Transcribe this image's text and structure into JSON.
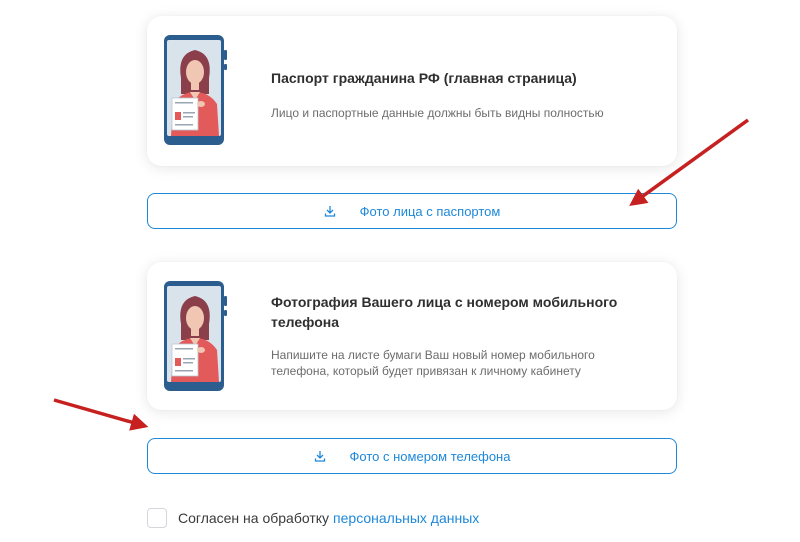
{
  "cards": [
    {
      "title": "Паспорт гражданина РФ (главная страница)",
      "description": "Лицо и паспортные данные должны быть видны полностью"
    },
    {
      "title": "Фотография Вашего лица с номером мобильного телефона",
      "description": "Напишите на листе бумаги Ваш новый номер мобильного телефона, который будет привязан к личному кабинету"
    }
  ],
  "buttons": {
    "photo_with_passport": "Фото лица с паспортом",
    "photo_with_phone": "Фото с номером телефона"
  },
  "consent": {
    "text": "Согласен на обработку",
    "link": "персональных данных",
    "checked": false
  },
  "colors": {
    "accent": "#1e88d9",
    "annotation_arrow": "#c62020",
    "phone_frame": "#2c5d8f"
  },
  "icons": [
    "phone-woman-passport-illustration",
    "download-icon",
    "red-arrow-annotation"
  ]
}
